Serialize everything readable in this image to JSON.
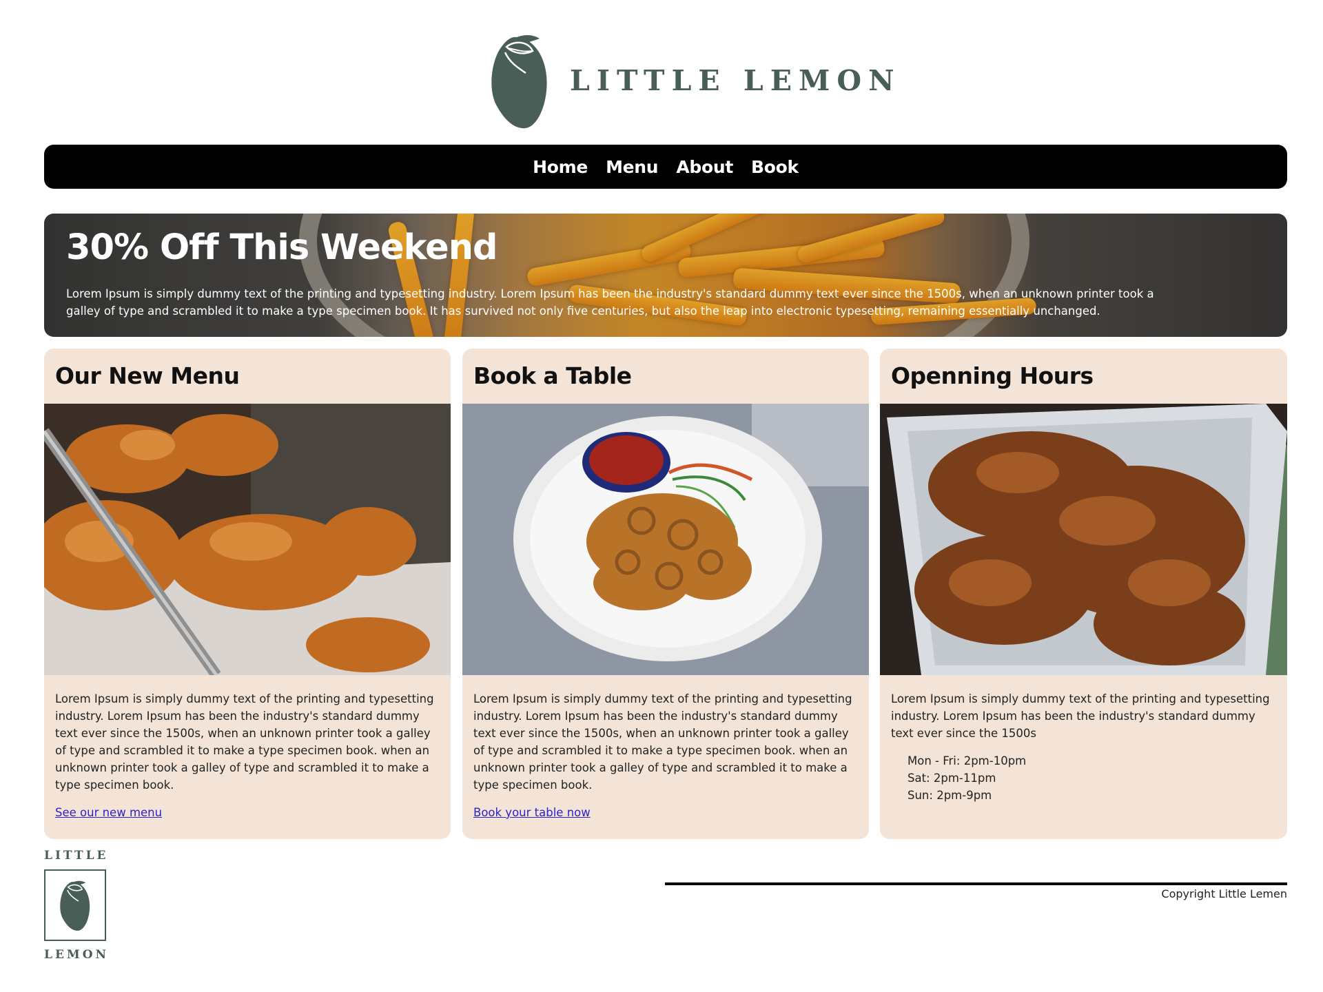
{
  "brand": {
    "name": "LITTLE LEMON",
    "footer_top": "LITTLE",
    "footer_bottom": "LEMON",
    "color": "#495e57"
  },
  "nav": {
    "items": [
      {
        "label": "Home"
      },
      {
        "label": "Menu"
      },
      {
        "label": "About"
      },
      {
        "label": "Book"
      }
    ]
  },
  "hero": {
    "title": "30% Off This Weekend",
    "text": "Lorem Ipsum is simply dummy text of the printing and typesetting industry. Lorem Ipsum has been the industry's standard dummy text ever since the 1500s, when an unknown printer took a galley of type and scrambled it to make a type specimen book. It has survived not only five centuries, but also the leap into electronic typesetting, remaining essentially unchanged."
  },
  "cards": [
    {
      "title": "Our New Menu",
      "text": "Lorem Ipsum is simply dummy text of the printing and typesetting industry. Lorem Ipsum has been the industry's standard dummy text ever since the 1500s, when an unknown printer took a galley of type and scrambled it to make a type specimen book. when an unknown printer took a galley of type and scrambled it to make a type specimen book.",
      "link": "See our new menu"
    },
    {
      "title": "Book a Table",
      "text": "Lorem Ipsum is simply dummy text of the printing and typesetting industry. Lorem Ipsum has been the industry's standard dummy text ever since the 1500s, when an unknown printer took a galley of type and scrambled it to make a type specimen book. when an unknown printer took a galley of type and scrambled it to make a type specimen book.",
      "link": "Book your table now"
    },
    {
      "title": "Openning Hours",
      "text": "Lorem Ipsum is simply dummy text of the printing and typesetting industry. Lorem Ipsum has been the industry's standard dummy text ever since the 1500s",
      "hours": [
        "Mon - Fri: 2pm-10pm",
        "Sat: 2pm-11pm",
        "Sun: 2pm-9pm"
      ]
    }
  ],
  "footer": {
    "copyright": "Copyright Little Lemen"
  },
  "colors": {
    "card_bg": "#f3e4d7",
    "nav_bg": "#000000",
    "link": "#2b22c9"
  }
}
